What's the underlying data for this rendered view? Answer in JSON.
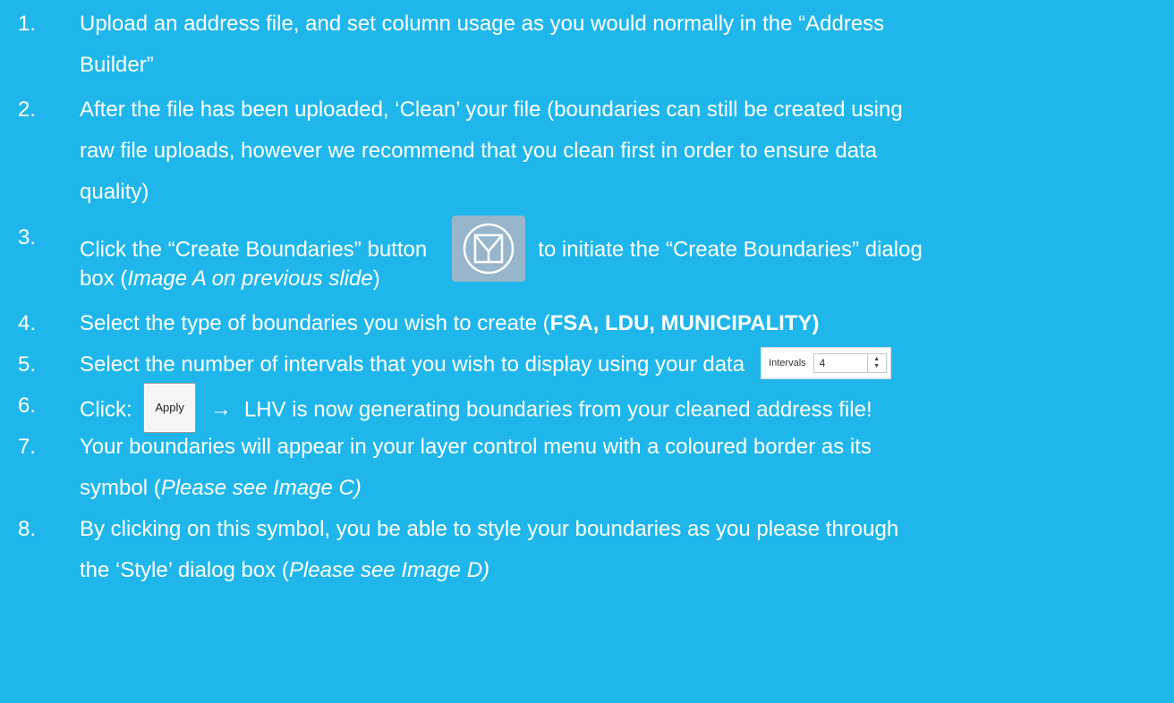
{
  "items": [
    {
      "num": "1.",
      "line1": "Upload an address file, and set column usage as you would normally in the “Address",
      "line2": "Builder”"
    },
    {
      "num": "2.",
      "line1": "After the file has been uploaded, ‘Clean’ your file (boundaries can still be created using",
      "line2": "raw file uploads, however we recommend that you clean first in order to ensure data",
      "line3": "quality)"
    },
    {
      "num": "3.",
      "line1_a": "Click the “Create Boundaries” button",
      "line1_b": "to initiate the “Create Boundaries” dialog",
      "line2_a": "box (",
      "line2_em": "Image A on previous slide",
      "line2_b": ")",
      "icon": "create-boundaries-icon"
    },
    {
      "num": "4.",
      "text_a": "Select the type of boundaries you wish to create (",
      "text_strong": "FSA, LDU, MUNICIPALITY)"
    },
    {
      "num": "5.",
      "text": "Select the number of intervals that you wish to display using your data",
      "intervals_label": "Intervals",
      "intervals_value": "4"
    },
    {
      "num": "6.",
      "text_a": "Click:",
      "apply_label": "Apply",
      "arrow": "→",
      "text_b": "LHV is now generating boundaries from your cleaned address file!"
    },
    {
      "num": "7.",
      "line1": "Your boundaries will appear in your layer control menu with a coloured border as its",
      "line2_a": "symbol (",
      "line2_em": "Please see Image C)"
    },
    {
      "num": "8.",
      "line1": "By clicking on this symbol, you be able to style your boundaries as you please through",
      "line2_a": "the ‘Style’ dialog box (",
      "line2_em": "Please see Image D)"
    }
  ],
  "colors": {
    "background": "#1fb7eb",
    "text": "#ffffff",
    "icon_bg": "#97b6cc"
  }
}
